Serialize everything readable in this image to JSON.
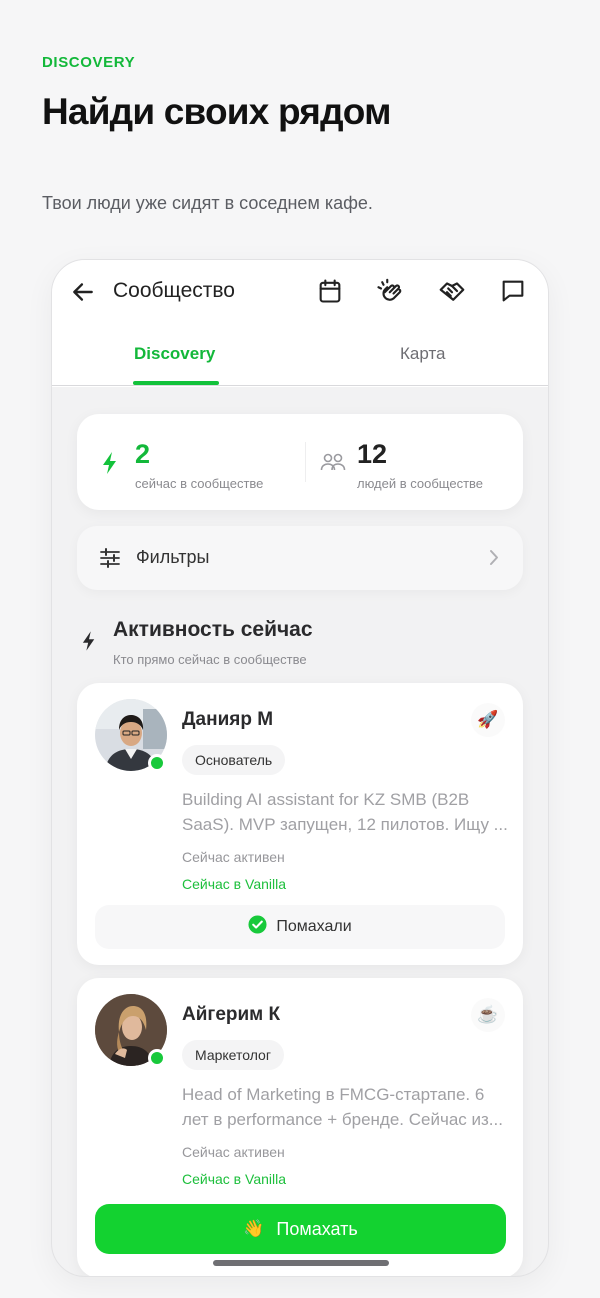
{
  "hero": {
    "eyebrow": "DISCOVERY",
    "headline": "Найди своих рядом",
    "subtitle": "Твои люди уже сидят в соседнем кафе."
  },
  "appbar": {
    "title": "Сообщество",
    "icons": [
      "back-arrow-icon",
      "calendar-icon",
      "clapping-hands-icon",
      "handshake-icon",
      "chat-icon"
    ]
  },
  "tabs": [
    {
      "label": "Discovery",
      "active": true
    },
    {
      "label": "Карта",
      "active": false
    }
  ],
  "stats": [
    {
      "value": "2",
      "label": "сейчас в сообществе",
      "icon": "lightning-icon",
      "color": "#13b83a"
    },
    {
      "value": "12",
      "label": "людей в сообществе",
      "icon": "people-icon",
      "color": "#222222"
    }
  ],
  "filters": {
    "label": "Фильтры"
  },
  "activity": {
    "title": "Активность сейчас",
    "subtitle": "Кто прямо сейчас в сообществе"
  },
  "people": [
    {
      "name": "Данияр М",
      "role": "Основатель",
      "emoji": "🚀",
      "bio_line1": "Building AI assistant for KZ SMB (B2B",
      "bio_line2": "SaaS). MVP запущен, 12 пилотов. Ищу ...",
      "status": "Сейчас активен",
      "location": "Сейчас в Vanilla",
      "action_label": "Помахали",
      "waved": true
    },
    {
      "name": "Айгерим К",
      "role": "Маркетолог",
      "emoji": "☕",
      "bio_line1": "Head of Marketing в FMCG-стартапе. 6",
      "bio_line2": "лет в performance + бренде. Сейчас из...",
      "status": "Сейчас активен",
      "location": "Сейчас в Vanilla",
      "action_label": "Помахать",
      "action_emoji": "👋",
      "waved": false
    }
  ],
  "colors": {
    "accent": "#13b83a",
    "button": "#13d230",
    "online": "#18c93b"
  }
}
